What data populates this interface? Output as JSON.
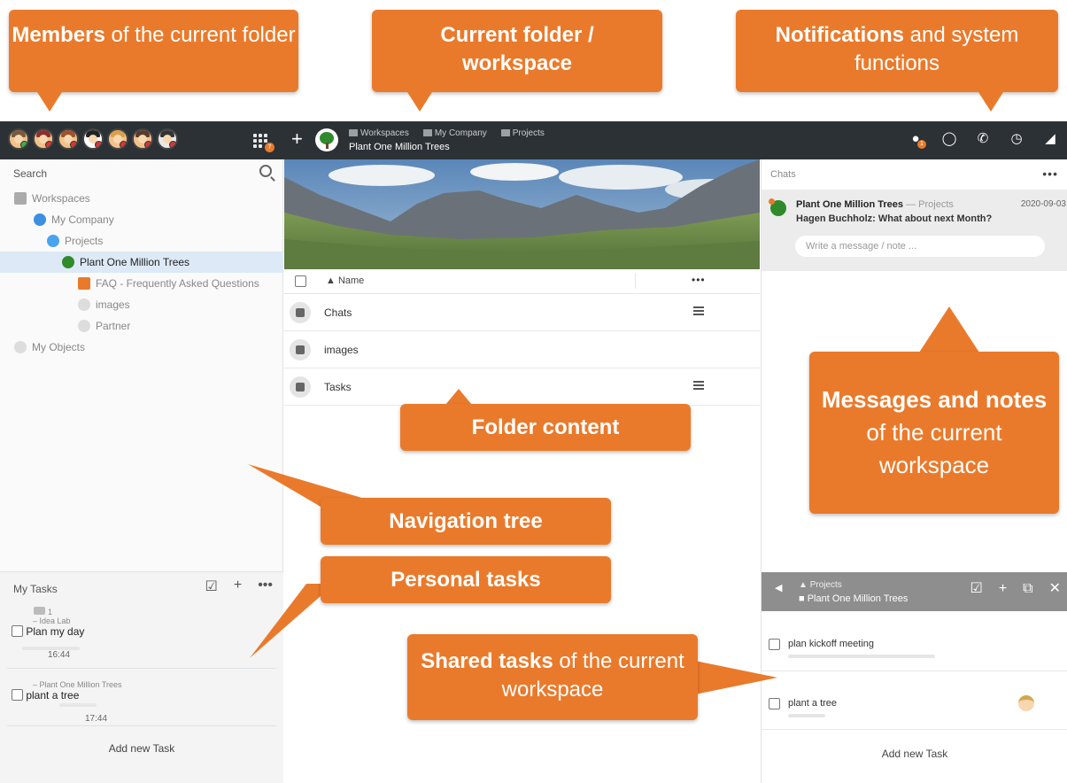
{
  "colors": {
    "topbar": "#2c3135",
    "accent_orange": "#ea7a2b",
    "selected_row": "#dde9f6",
    "badge": "#e97a2c",
    "tree_green": "#2f8a2b"
  },
  "topbar": {
    "avatar_count": 7,
    "apps_badge": "7",
    "add_symbol": "+",
    "breadcrumbs": [
      "Workspaces",
      "My Company",
      "Projects"
    ],
    "title": "Plant One Million Trees",
    "icons": [
      "bell-icon",
      "share-icon",
      "phone-icon",
      "clock-icon",
      "logo-icon"
    ],
    "bell_badge": "1"
  },
  "left": {
    "search_label": "Search",
    "tree": [
      {
        "label": "Workspaces",
        "level": 0
      },
      {
        "label": "My Company",
        "level": 1
      },
      {
        "label": "Projects",
        "level": 2
      },
      {
        "label": "Plant One Million Trees",
        "level": 3,
        "selected": true
      },
      {
        "label": "FAQ - Frequently Asked Questions",
        "level": 4
      },
      {
        "label": "images",
        "level": 4
      },
      {
        "label": "Partner",
        "level": 4
      },
      {
        "label": "My Objects",
        "level": 0
      }
    ],
    "my_tasks": {
      "title": "My Tasks",
      "tasks": [
        {
          "comments": "1",
          "context": "– Idea Lab",
          "title": "Plan my day",
          "time": "16:44"
        },
        {
          "context": "– Plant One Million Trees",
          "title": "plant a tree",
          "time": "17:44"
        }
      ],
      "add_label": "Add new Task"
    }
  },
  "center": {
    "column_name": "Name",
    "rows": [
      {
        "label": "Chats",
        "icon": "chat-icon",
        "has_menu": true
      },
      {
        "label": "images",
        "icon": "folder-icon",
        "has_menu": false
      },
      {
        "label": "Tasks",
        "icon": "tasks-icon",
        "has_menu": true
      }
    ]
  },
  "right": {
    "chats_title": "Chats",
    "chat": {
      "title": "Plant One Million Trees",
      "context": "— Projects",
      "date": "2020-09-03",
      "message": "Hagen Buchholz: What about next Month?",
      "input_placeholder": "Write a message / note ..."
    },
    "shared": {
      "parent": "Projects",
      "current": "Plant One Million Trees",
      "tasks": [
        "plan kickoff meeting",
        "plant a tree"
      ],
      "add_label": "Add new Task"
    }
  },
  "callouts": {
    "members": {
      "bold": "Members",
      "rest": " of the current folder"
    },
    "current_folder": {
      "bold": "Current folder / workspace"
    },
    "notifications": {
      "bold": "Notifications",
      "rest": " and system functions"
    },
    "folder_content": {
      "bold": "Folder content"
    },
    "messages": {
      "bold": "Messages and notes",
      "rest": " of the current workspace"
    },
    "navigation": {
      "bold": "Navigation tree"
    },
    "personal": {
      "bold": "Personal tasks"
    },
    "shared": {
      "bold": "Shared tasks",
      "rest": " of the current workspace"
    }
  }
}
